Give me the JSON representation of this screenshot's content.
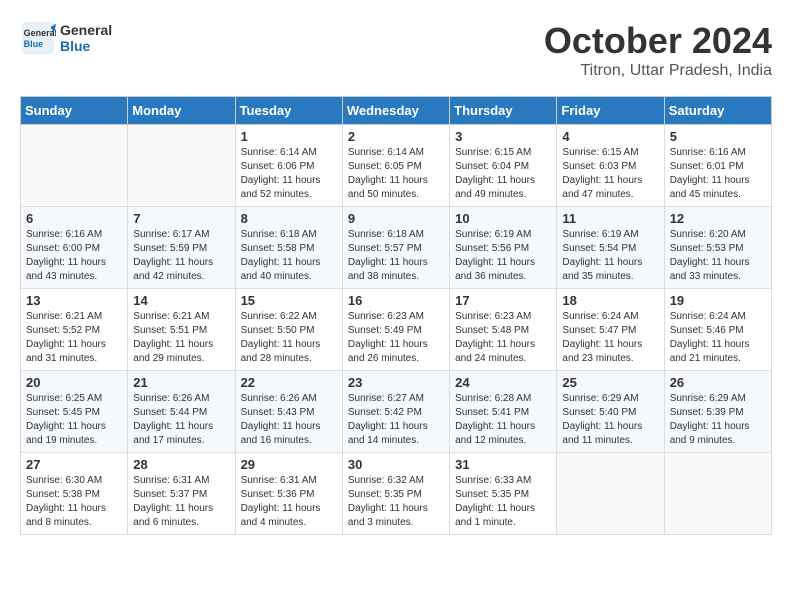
{
  "header": {
    "logo_line1": "General",
    "logo_line2": "Blue",
    "month": "October 2024",
    "location": "Titron, Uttar Pradesh, India"
  },
  "days_of_week": [
    "Sunday",
    "Monday",
    "Tuesday",
    "Wednesday",
    "Thursday",
    "Friday",
    "Saturday"
  ],
  "weeks": [
    [
      {
        "day": "",
        "info": ""
      },
      {
        "day": "",
        "info": ""
      },
      {
        "day": "1",
        "info": "Sunrise: 6:14 AM\nSunset: 6:06 PM\nDaylight: 11 hours and 52 minutes."
      },
      {
        "day": "2",
        "info": "Sunrise: 6:14 AM\nSunset: 6:05 PM\nDaylight: 11 hours and 50 minutes."
      },
      {
        "day": "3",
        "info": "Sunrise: 6:15 AM\nSunset: 6:04 PM\nDaylight: 11 hours and 49 minutes."
      },
      {
        "day": "4",
        "info": "Sunrise: 6:15 AM\nSunset: 6:03 PM\nDaylight: 11 hours and 47 minutes."
      },
      {
        "day": "5",
        "info": "Sunrise: 6:16 AM\nSunset: 6:01 PM\nDaylight: 11 hours and 45 minutes."
      }
    ],
    [
      {
        "day": "6",
        "info": "Sunrise: 6:16 AM\nSunset: 6:00 PM\nDaylight: 11 hours and 43 minutes."
      },
      {
        "day": "7",
        "info": "Sunrise: 6:17 AM\nSunset: 5:59 PM\nDaylight: 11 hours and 42 minutes."
      },
      {
        "day": "8",
        "info": "Sunrise: 6:18 AM\nSunset: 5:58 PM\nDaylight: 11 hours and 40 minutes."
      },
      {
        "day": "9",
        "info": "Sunrise: 6:18 AM\nSunset: 5:57 PM\nDaylight: 11 hours and 38 minutes."
      },
      {
        "day": "10",
        "info": "Sunrise: 6:19 AM\nSunset: 5:56 PM\nDaylight: 11 hours and 36 minutes."
      },
      {
        "day": "11",
        "info": "Sunrise: 6:19 AM\nSunset: 5:54 PM\nDaylight: 11 hours and 35 minutes."
      },
      {
        "day": "12",
        "info": "Sunrise: 6:20 AM\nSunset: 5:53 PM\nDaylight: 11 hours and 33 minutes."
      }
    ],
    [
      {
        "day": "13",
        "info": "Sunrise: 6:21 AM\nSunset: 5:52 PM\nDaylight: 11 hours and 31 minutes."
      },
      {
        "day": "14",
        "info": "Sunrise: 6:21 AM\nSunset: 5:51 PM\nDaylight: 11 hours and 29 minutes."
      },
      {
        "day": "15",
        "info": "Sunrise: 6:22 AM\nSunset: 5:50 PM\nDaylight: 11 hours and 28 minutes."
      },
      {
        "day": "16",
        "info": "Sunrise: 6:23 AM\nSunset: 5:49 PM\nDaylight: 11 hours and 26 minutes."
      },
      {
        "day": "17",
        "info": "Sunrise: 6:23 AM\nSunset: 5:48 PM\nDaylight: 11 hours and 24 minutes."
      },
      {
        "day": "18",
        "info": "Sunrise: 6:24 AM\nSunset: 5:47 PM\nDaylight: 11 hours and 23 minutes."
      },
      {
        "day": "19",
        "info": "Sunrise: 6:24 AM\nSunset: 5:46 PM\nDaylight: 11 hours and 21 minutes."
      }
    ],
    [
      {
        "day": "20",
        "info": "Sunrise: 6:25 AM\nSunset: 5:45 PM\nDaylight: 11 hours and 19 minutes."
      },
      {
        "day": "21",
        "info": "Sunrise: 6:26 AM\nSunset: 5:44 PM\nDaylight: 11 hours and 17 minutes."
      },
      {
        "day": "22",
        "info": "Sunrise: 6:26 AM\nSunset: 5:43 PM\nDaylight: 11 hours and 16 minutes."
      },
      {
        "day": "23",
        "info": "Sunrise: 6:27 AM\nSunset: 5:42 PM\nDaylight: 11 hours and 14 minutes."
      },
      {
        "day": "24",
        "info": "Sunrise: 6:28 AM\nSunset: 5:41 PM\nDaylight: 11 hours and 12 minutes."
      },
      {
        "day": "25",
        "info": "Sunrise: 6:29 AM\nSunset: 5:40 PM\nDaylight: 11 hours and 11 minutes."
      },
      {
        "day": "26",
        "info": "Sunrise: 6:29 AM\nSunset: 5:39 PM\nDaylight: 11 hours and 9 minutes."
      }
    ],
    [
      {
        "day": "27",
        "info": "Sunrise: 6:30 AM\nSunset: 5:38 PM\nDaylight: 11 hours and 8 minutes."
      },
      {
        "day": "28",
        "info": "Sunrise: 6:31 AM\nSunset: 5:37 PM\nDaylight: 11 hours and 6 minutes."
      },
      {
        "day": "29",
        "info": "Sunrise: 6:31 AM\nSunset: 5:36 PM\nDaylight: 11 hours and 4 minutes."
      },
      {
        "day": "30",
        "info": "Sunrise: 6:32 AM\nSunset: 5:35 PM\nDaylight: 11 hours and 3 minutes."
      },
      {
        "day": "31",
        "info": "Sunrise: 6:33 AM\nSunset: 5:35 PM\nDaylight: 11 hours and 1 minute."
      },
      {
        "day": "",
        "info": ""
      },
      {
        "day": "",
        "info": ""
      }
    ]
  ]
}
